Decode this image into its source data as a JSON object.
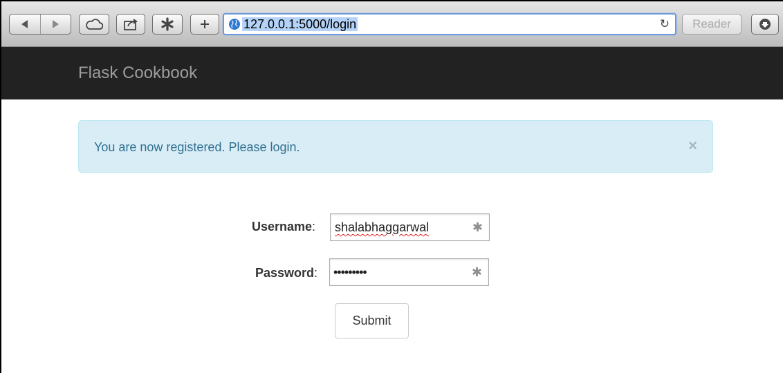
{
  "browser": {
    "url": "127.0.0.1:5000/login",
    "reader_label": "Reader",
    "icons": {
      "back": "back-arrow-icon",
      "forward": "forward-arrow-icon",
      "cloud": "cloud-icon",
      "share": "share-icon",
      "snippet": "asterisk-icon",
      "new_tab": "plus-icon",
      "site": "globe-icon",
      "reload": "reload-icon",
      "downloads": "download-icon"
    }
  },
  "navbar": {
    "brand": "Flask Cookbook"
  },
  "alert": {
    "message": "You are now registered. Please login.",
    "close": "×"
  },
  "form": {
    "username_label": "Username",
    "username_value": "shalabhaggarwal",
    "password_label": "Password",
    "password_value": "•••••••••",
    "key_glyph": "✱",
    "submit_label": "Submit"
  },
  "colors": {
    "navbar_bg": "#222222",
    "brand_text": "#9d9d9d",
    "alert_bg": "#d9edf7",
    "alert_text": "#31708f"
  }
}
